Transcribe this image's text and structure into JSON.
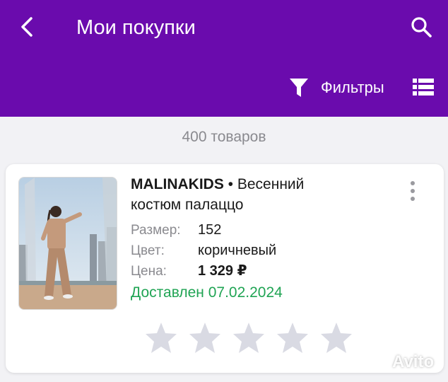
{
  "header": {
    "title": "Мои покупки",
    "filter_label": "Фильтры",
    "background_color": "#6a0bad"
  },
  "icons": {
    "back": "chevron-left-icon",
    "search": "search-icon",
    "filter": "filter-funnel-icon",
    "list_view": "list-view-icon",
    "more": "more-vertical-icon"
  },
  "summary": {
    "count_text": "400 товаров"
  },
  "product": {
    "brand": "MALINAKIDS",
    "separator": " • ",
    "name_line1": "Весенний",
    "name_line2": "костюм палаццо",
    "size_label": "Размер:",
    "size_value": "152",
    "color_label": "Цвет:",
    "color_value": "коричневый",
    "price_label": "Цена:",
    "price_value": "1 329 ₽",
    "status": "Доставлен 07.02.2024",
    "status_color": "#20a454"
  },
  "rating": {
    "max_stars": 5,
    "selected": 0
  },
  "watermark": {
    "text": "Avito"
  }
}
